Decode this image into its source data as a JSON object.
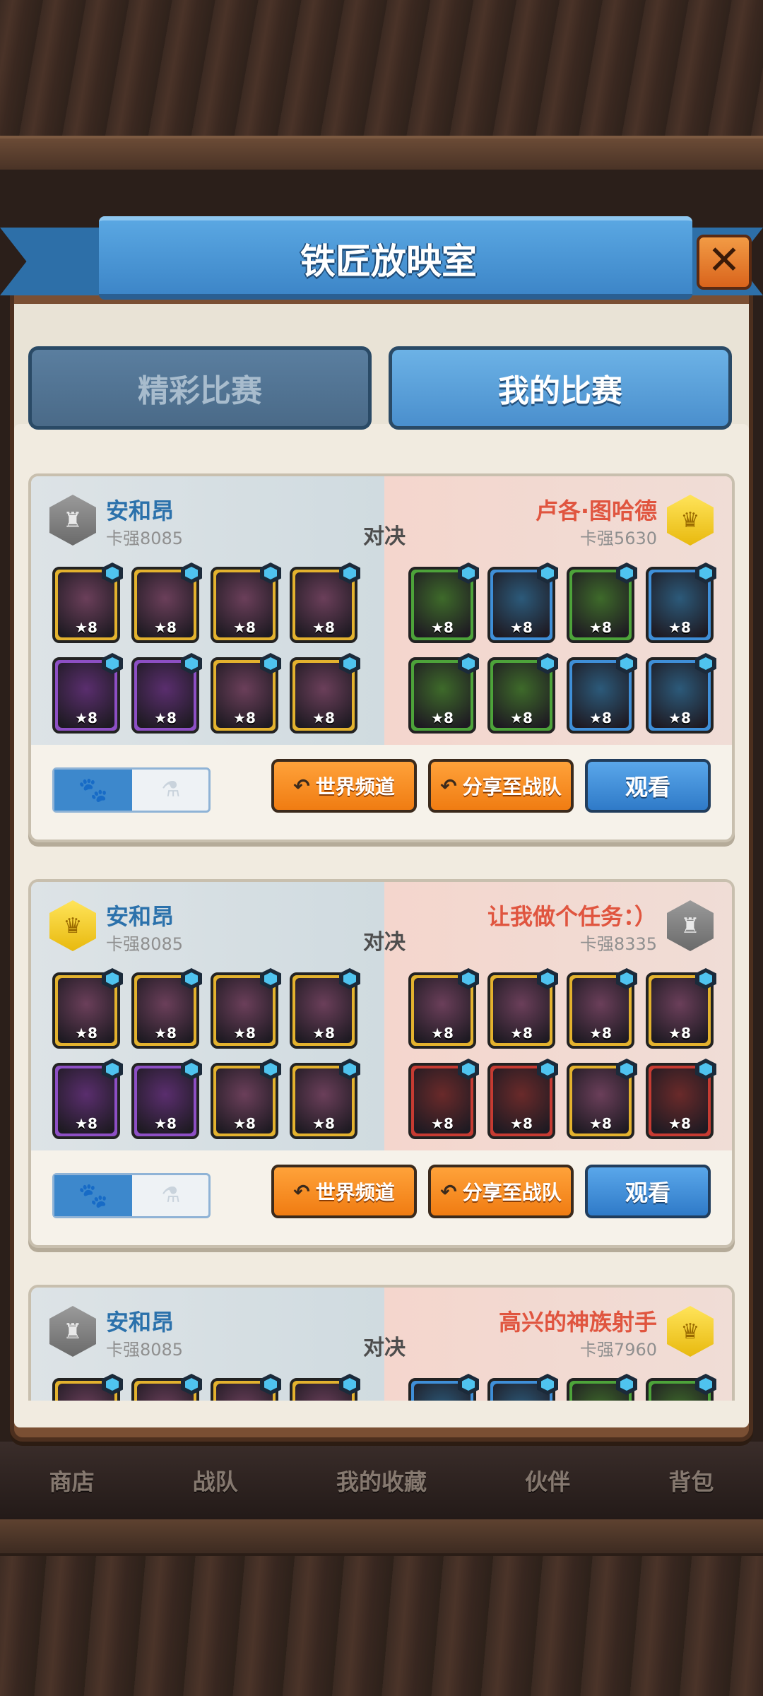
{
  "dialog": {
    "title": "铁匠放映室",
    "close_label": "✕",
    "tabs": [
      {
        "label": "精彩比赛",
        "active": false
      },
      {
        "label": "我的比赛",
        "active": true
      }
    ]
  },
  "bottom_nav": [
    "商店",
    "战队",
    "我的收藏",
    "伙伴",
    "背包"
  ],
  "vs_label": "对决",
  "buttons": {
    "world_channel": "世界频道",
    "share_team": "分享至战队",
    "watch": "观看"
  },
  "matches": [
    {
      "left": {
        "name": "安和昂",
        "power": "卡强8085",
        "badge": "silver"
      },
      "right": {
        "name": "卢各·图哈德",
        "power": "卡强5630",
        "badge": "gold"
      },
      "left_heroes": [
        "gold",
        "gold",
        "gold",
        "gold",
        "purple",
        "purple",
        "gold",
        "gold"
      ],
      "right_heroes": [
        "green",
        "blue",
        "green",
        "blue",
        "green",
        "green",
        "blue",
        "blue"
      ],
      "hero_level": "★8"
    },
    {
      "left": {
        "name": "安和昂",
        "power": "卡强8085",
        "badge": "gold"
      },
      "right": {
        "name": "让我做个任务：）",
        "power": "卡强8335",
        "badge": "silver"
      },
      "left_heroes": [
        "gold",
        "gold",
        "gold",
        "gold",
        "purple",
        "purple",
        "gold",
        "gold"
      ],
      "right_heroes": [
        "gold",
        "gold",
        "gold",
        "gold",
        "red",
        "red",
        "gold",
        "red"
      ],
      "hero_level": "★8"
    },
    {
      "left": {
        "name": "安和昂",
        "power": "卡强8085",
        "badge": "silver"
      },
      "right": {
        "name": "高兴的神族射手",
        "power": "卡强7960",
        "badge": "gold"
      },
      "left_heroes": [
        "gold",
        "gold",
        "gold",
        "gold"
      ],
      "right_heroes": [
        "blue",
        "blue",
        "green",
        "green"
      ],
      "hero_level": "★8"
    }
  ]
}
